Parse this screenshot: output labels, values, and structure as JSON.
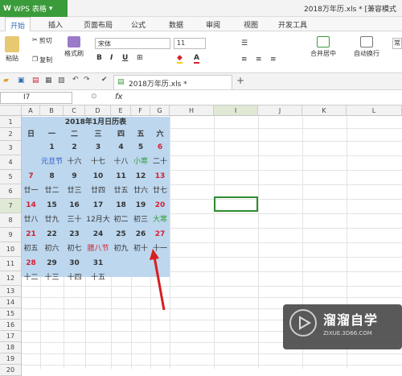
{
  "app": {
    "logo": "W",
    "name": "WPS 表格",
    "doc_title": "2018万年历.xls * [兼容模式"
  },
  "menu": {
    "tabs": [
      "开始",
      "插入",
      "页面布局",
      "公式",
      "数据",
      "审阅",
      "视图",
      "开发工具"
    ]
  },
  "ribbon": {
    "paste": "粘贴",
    "cut": "剪切",
    "copy": "复制",
    "format_painter": "格式刷",
    "font_name": "宋体",
    "font_size": "11",
    "merge_center": "合并居中",
    "wrap_text": "自动换行",
    "number_format": "常"
  },
  "toolbar2": {
    "file_tab": "2018万年历.xls *"
  },
  "formula": {
    "cell_ref": "I7",
    "fx": "fx"
  },
  "columns": [
    "A",
    "B",
    "C",
    "D",
    "E",
    "F",
    "G",
    "H",
    "I",
    "J",
    "K",
    "L"
  ],
  "rows": [
    "1",
    "2",
    "3",
    "4",
    "5",
    "6",
    "7",
    "8",
    "9",
    "10",
    "11",
    "12",
    "13",
    "14",
    "15",
    "16",
    "17",
    "18",
    "19",
    "20",
    "21"
  ],
  "calendar": {
    "title": "2018年1月日历表",
    "weekdays": [
      "日",
      "一",
      "二",
      "三",
      "四",
      "五",
      "六"
    ],
    "weeks": [
      {
        "dates": [
          "",
          "1",
          "2",
          "3",
          "4",
          "5",
          "6"
        ],
        "lunar": [
          "",
          "元旦节",
          "十六",
          "十七",
          "十八",
          "小寒",
          "二十"
        ]
      },
      {
        "dates": [
          "7",
          "8",
          "9",
          "10",
          "11",
          "12",
          "13"
        ],
        "lunar": [
          "廿一",
          "廿二",
          "廿三",
          "廿四",
          "廿五",
          "廿六",
          "廿七"
        ]
      },
      {
        "dates": [
          "14",
          "15",
          "16",
          "17",
          "18",
          "19",
          "20"
        ],
        "lunar": [
          "廿八",
          "廿九",
          "三十",
          "12月大",
          "初二",
          "初三",
          "大寒"
        ]
      },
      {
        "dates": [
          "21",
          "22",
          "23",
          "24",
          "25",
          "26",
          "27"
        ],
        "lunar": [
          "初五",
          "初六",
          "初七",
          "腊八节",
          "初九",
          "初十",
          "十一"
        ]
      },
      {
        "dates": [
          "28",
          "29",
          "30",
          "31",
          "",
          "",
          ""
        ],
        "lunar": [
          "十二",
          "十三",
          "十四",
          "十五",
          "",
          "",
          ""
        ]
      }
    ]
  },
  "watermark": {
    "name": "溜溜自学",
    "site": "ZIXUE.3D66.COM"
  },
  "colors": {
    "accent": "#3a9b3a",
    "calendar_bg": "#bdd7ee",
    "holiday": "#d42030",
    "festival": "#2550c8",
    "solar_term": "#2e9e3a"
  }
}
